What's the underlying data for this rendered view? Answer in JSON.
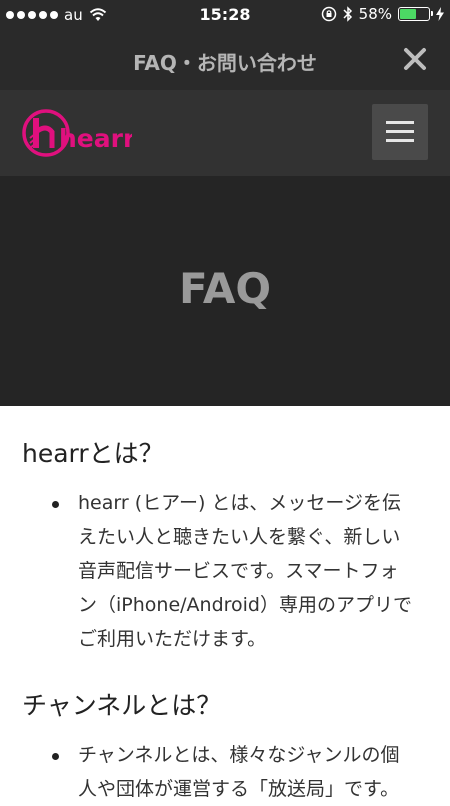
{
  "status_bar": {
    "carrier": "au",
    "time": "15:28",
    "battery": "58%",
    "battery_level": 0.58
  },
  "title_bar": {
    "title": "FAQ・お問い合わせ"
  },
  "header": {
    "logo_text": "hearr"
  },
  "hero": {
    "title": "FAQ"
  },
  "faq": [
    {
      "question": "hearrとは？",
      "answer_lines": [
        "hearr (ヒアー) とは、メッセージを伝",
        "えたい人と聴きたい人を繋ぐ、新しい",
        "音声配信サービスです。スマートフォ",
        "ン（iPhone/Android）専用のアプリで",
        "ご利用いただけます。"
      ]
    },
    {
      "question": "チャンネルとは？",
      "answer_lines": [
        "チャンネルとは、様々なジャンルの個",
        "人や団体が運営する「放送局」です。"
      ]
    }
  ],
  "colors": {
    "brand": "#e0107e",
    "bar_dark": "#2a2a2a",
    "header": "#323232",
    "hero": "#252525"
  },
  "icons": {
    "signal": "signal-dots-icon",
    "wifi": "wifi-icon",
    "lock": "orientation-lock-icon",
    "bluetooth": "bluetooth-icon",
    "battery": "battery-icon",
    "charging": "charging-bolt-icon",
    "close": "close-icon",
    "menu": "hamburger-menu-icon"
  }
}
